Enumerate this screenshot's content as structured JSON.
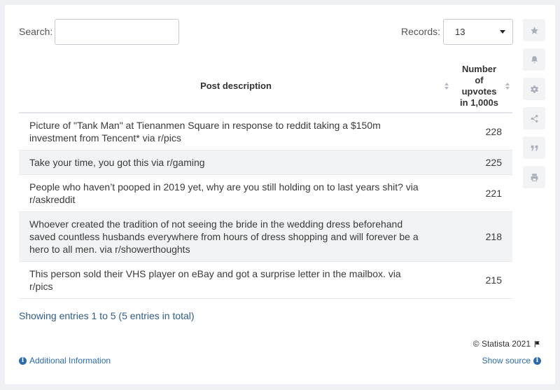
{
  "search": {
    "label": "Search:",
    "value": ""
  },
  "records": {
    "label": "Records:",
    "selected": "13"
  },
  "table": {
    "headers": {
      "description": "Post description",
      "upvotes_lines": [
        "Number",
        "of",
        "upvotes",
        "in 1,000s"
      ]
    },
    "rows": [
      {
        "description": "Picture of \"Tank Man\" at Tienanmen Square in response to reddit taking a $150m investment from Tencent* via r/pics",
        "upvotes": "228"
      },
      {
        "description": "Take your time, you got this via r/gaming",
        "upvotes": "225"
      },
      {
        "description": "People who haven’t pooped in 2019 yet, why are you still holding on to last years shit? via r/askreddit",
        "upvotes": "221"
      },
      {
        "description": "Whoever created the tradition of not seeing the bride in the wedding dress beforehand saved countless husbands everywhere from hours of dress shopping and will forever be a hero to all men. via r/showerthoughts",
        "upvotes": "218"
      },
      {
        "description": "This person sold their VHS player on eBay and got a surprise letter in the mailbox. via r/pics",
        "upvotes": "215"
      }
    ]
  },
  "footer": {
    "entries_info": "Showing entries 1 to 5 (5 entries in total)",
    "copyright": "© Statista 2021",
    "additional_info": "Additional Information",
    "show_source": "Show source"
  },
  "side_tools": [
    "star-icon",
    "bell-icon",
    "gear-icon",
    "share-icon",
    "quote-icon",
    "print-icon"
  ],
  "colors": {
    "link": "#2b6cb0",
    "stripe": "#f1f3f5",
    "background": "#eef0f3"
  }
}
